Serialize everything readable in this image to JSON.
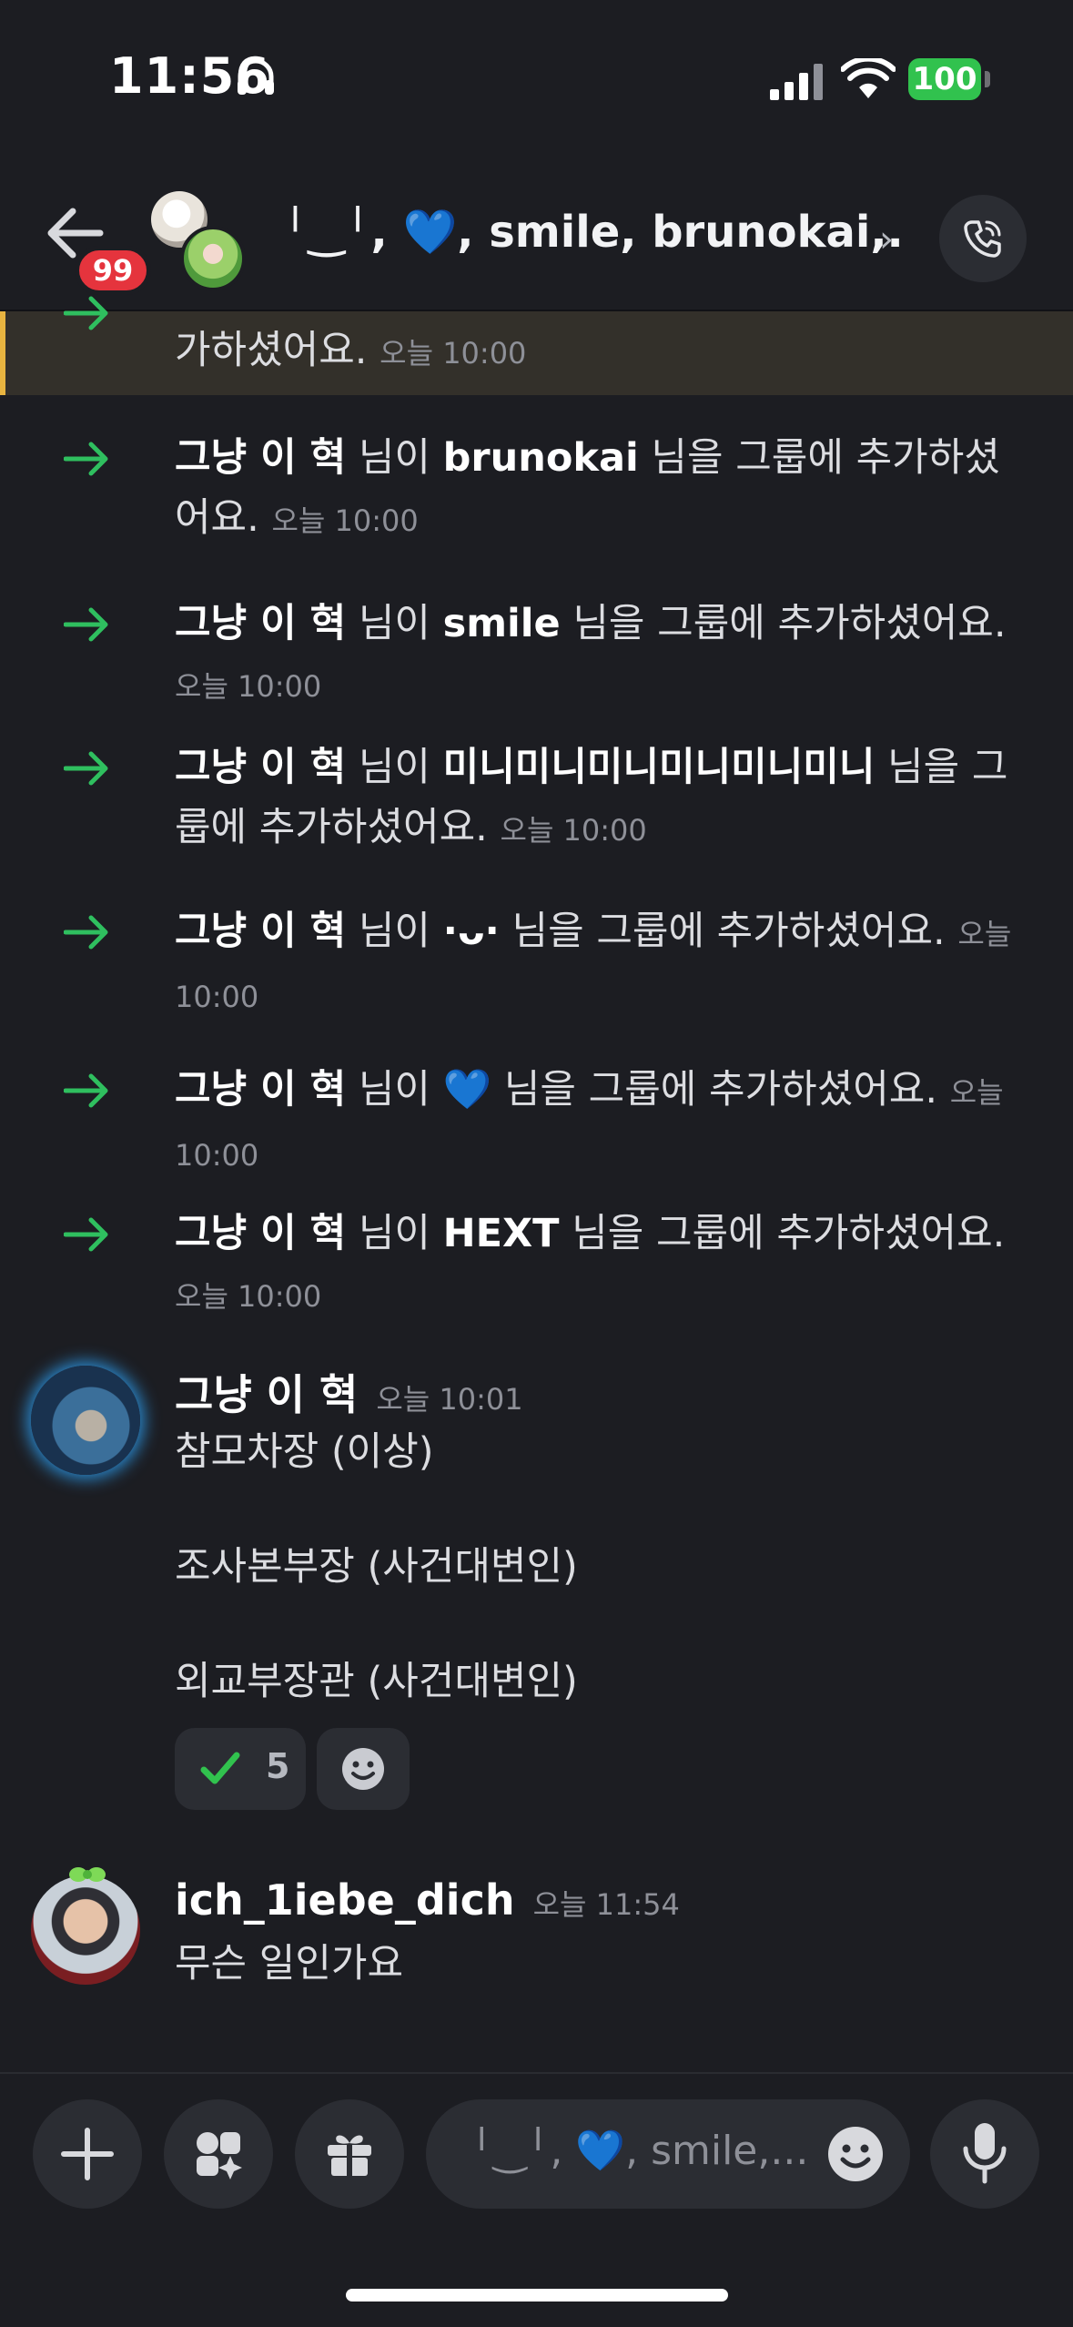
{
  "status_bar": {
    "time": "11:56",
    "battery": "100"
  },
  "header": {
    "back_badge": "99",
    "title": "╵‿╵, 💙, smile, brunokai,...",
    "chevron": "›"
  },
  "highlighted": {
    "text": "가하셨어요.",
    "timestamp": "오늘 10:00"
  },
  "system_messages": [
    {
      "actor": "그냥 이 혁",
      "mid": " 님이 ",
      "target": "brunokai",
      "tail": " 님을 그룹에 추가하셨어요. ",
      "timestamp": "오늘 10:00"
    },
    {
      "actor": "그냥 이 혁",
      "mid": " 님이 ",
      "target": "smile",
      "tail": " 님을 그룹에 추가하셨어요. ",
      "timestamp": "오늘 10:00"
    },
    {
      "actor": "그냥 이 혁",
      "mid": " 님이 ",
      "target": "미니미니미니미니미니미니",
      "tail": " 님을 그룹에 추가하셨어요. ",
      "timestamp": "오늘 10:00"
    },
    {
      "actor": "그냥 이 혁",
      "mid": " 님이 ",
      "target": "·ᴗ·",
      "tail": " 님을 그룹에 추가하셨어요. ",
      "timestamp": "오늘 10:00"
    },
    {
      "actor": "그냥 이 혁",
      "mid": " 님이 ",
      "target": "💙",
      "tail": " 님을 그룹에 추가하셨어요. ",
      "timestamp": "오늘 10:00"
    },
    {
      "actor": "그냥 이 혁",
      "mid": " 님이 ",
      "target": "HEXT",
      "tail": " 님을 그룹에 추가하셨어요. ",
      "timestamp": "오늘 10:00"
    }
  ],
  "messages": [
    {
      "author": "그냥 이 혁",
      "timestamp": "오늘 10:01",
      "lines": [
        "참모차장 (이상)",
        "조사본부장 (사건대변인)",
        "외교부장관 (사건대변인)"
      ],
      "reaction": {
        "emoji": "check-mark",
        "count": "5"
      }
    },
    {
      "author": "ich_1iebe_dich",
      "timestamp": "오늘 11:54",
      "lines": [
        "무슨 일인가요"
      ]
    }
  ],
  "composer": {
    "placeholder": "╵‿╵, 💙, smile,..."
  },
  "colors": {
    "background": "#1c1d22",
    "accent_green": "#2fbf5f",
    "badge_red": "#e5343d",
    "highlight_bar": "#e8b440"
  }
}
